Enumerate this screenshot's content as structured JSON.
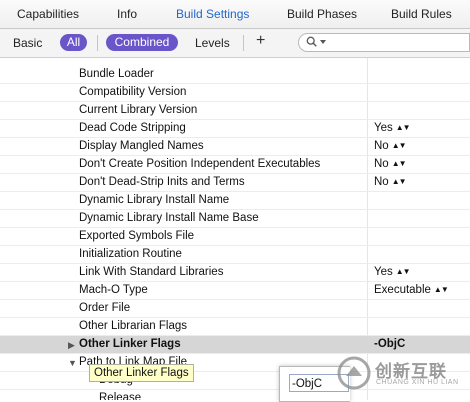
{
  "tabs": [
    {
      "label": "Capabilities"
    },
    {
      "label": "Info"
    },
    {
      "label": "Build Settings",
      "active": true
    },
    {
      "label": "Build Phases"
    },
    {
      "label": "Build Rules"
    }
  ],
  "filter_bar": {
    "basic": "Basic",
    "all": "All",
    "combined": "Combined",
    "levels": "Levels",
    "add": "+",
    "search_placeholder": ""
  },
  "settings": [
    {
      "name": "Bundle Loader",
      "value": ""
    },
    {
      "name": "Compatibility Version",
      "value": ""
    },
    {
      "name": "Current Library Version",
      "value": ""
    },
    {
      "name": "Dead Code Stripping",
      "value": "Yes"
    },
    {
      "name": "Display Mangled Names",
      "value": "No"
    },
    {
      "name": "Don't Create Position Independent Executables",
      "value": "No"
    },
    {
      "name": "Don't Dead-Strip Inits and Terms",
      "value": "No"
    },
    {
      "name": "Dynamic Library Install Name",
      "value": ""
    },
    {
      "name": "Dynamic Library Install Name Base",
      "value": ""
    },
    {
      "name": "Exported Symbols File",
      "value": ""
    },
    {
      "name": "Initialization Routine",
      "value": ""
    },
    {
      "name": "Link With Standard Libraries",
      "value": "Yes"
    },
    {
      "name": "Mach-O Type",
      "value": "Executable"
    },
    {
      "name": "Order File",
      "value": ""
    },
    {
      "name": "Other Librarian Flags",
      "value": ""
    },
    {
      "name": "Other Linker Flags",
      "value": "-ObjC"
    },
    {
      "name": "Path to Link Map File",
      "value": ""
    },
    {
      "name": "Debug",
      "value": ""
    },
    {
      "name": "Release",
      "value": ""
    }
  ],
  "tooltip": "Other Linker Flags",
  "edit_popup": {
    "value": "-ObjC"
  },
  "watermark": {
    "cn": "创新互联",
    "en": "CHUANG XIN HU LIAN"
  },
  "colors": {
    "accent_pill": "#6a55c9",
    "active_tab": "#2266cc",
    "tooltip_bg": "#ffffc8"
  }
}
